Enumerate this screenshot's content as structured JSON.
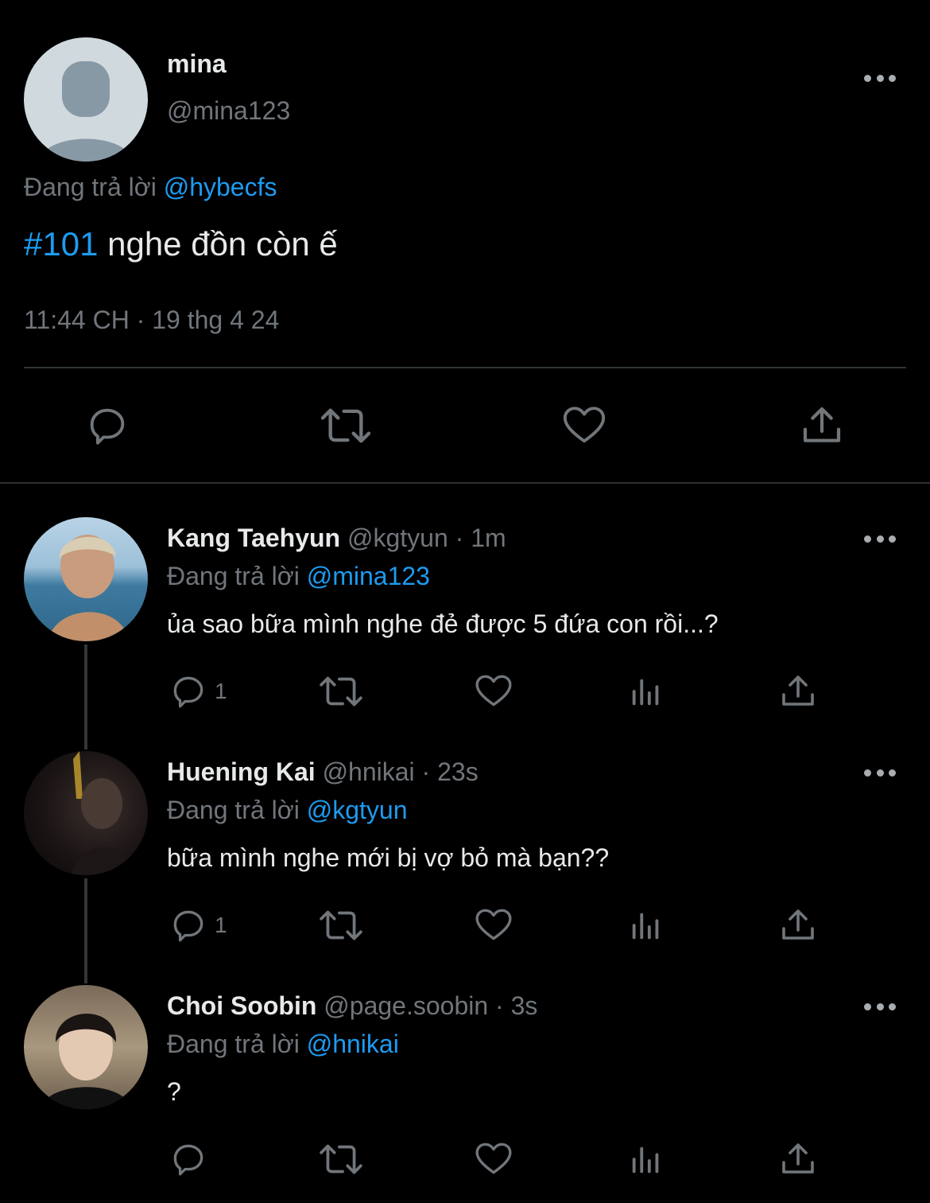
{
  "main_tweet": {
    "display_name": "mina",
    "handle": "@mina123",
    "replying_prefix": "Đang trả lời",
    "replying_to": "@hybecfs",
    "hashtag": "#101",
    "text": "nghe đồn còn ế",
    "timestamp": "11:44 CH · 19 thg 4 24",
    "actions": [
      "reply",
      "retweet",
      "like",
      "share"
    ]
  },
  "replies": [
    {
      "display_name": "Kang Taehyun",
      "handle": "@kgtyun",
      "time": "· 1m",
      "replying_prefix": "Đang trả lời",
      "replying_to": "@mina123",
      "text": "ủa sao bữa mình nghe đẻ được 5 đứa con rồi...?",
      "reply_count": "1"
    },
    {
      "display_name": "Huening Kai",
      "handle": "@hnikai",
      "time": "· 23s",
      "replying_prefix": "Đang trả lời",
      "replying_to": "@kgtyun",
      "text": "bữa mình nghe mới bị vợ bỏ mà bạn??",
      "reply_count": "1"
    },
    {
      "display_name": "Choi Soobin",
      "handle": "@page.soobin",
      "time": "· 3s",
      "replying_prefix": "Đang trả lời",
      "replying_to": "@hnikai",
      "text": "?",
      "reply_count": ""
    }
  ],
  "colors": {
    "background": "#000000",
    "accent": "#1d9bf0",
    "secondary_text": "#71767b",
    "primary_text": "#e7e9ea"
  }
}
